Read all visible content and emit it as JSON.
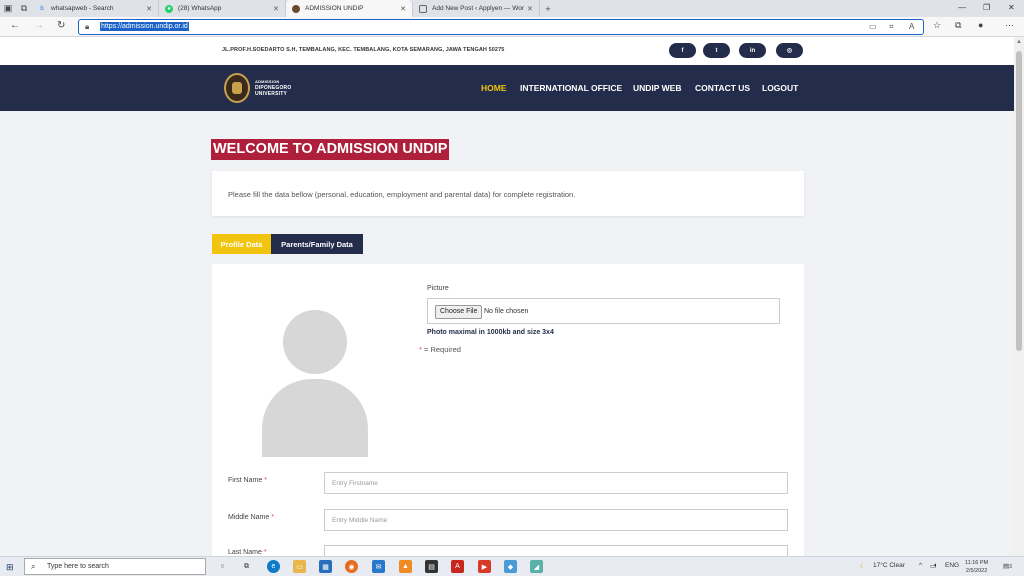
{
  "browser": {
    "tabs": [
      {
        "title": "whatsapweb - Search",
        "icon": "bing-icon",
        "color": "#1a73e8"
      },
      {
        "title": "(28) WhatsApp",
        "icon": "whatsapp-icon",
        "color": "#25d366"
      },
      {
        "title": "ADMISSION UNDIP",
        "icon": "undip-icon",
        "color": "#6b4a2e"
      },
      {
        "title": "Add New Post ‹ Applyen — Wor",
        "icon": "page-icon",
        "color": "#666666"
      }
    ],
    "new_tab": "+",
    "url": "https://admission.undip.or.id"
  },
  "site": {
    "address": "JL.PROF.H.SOEDARTO S.H, TEMBALANG, KEC. TEMBALANG, KOTA SEMARANG, JAWA TENGAH 50275",
    "social": [
      "f",
      "t",
      "in",
      "◎"
    ],
    "logo": {
      "line1": "ADMISSION",
      "line2": "DIPONEGORO",
      "line3": "UNIVERSITY"
    },
    "menu": [
      "HOME",
      "INTERNATIONAL OFFICE",
      "UNDIP WEB",
      "CONTACT US",
      "LOGOUT"
    ],
    "active_menu": "HOME",
    "welcome": "WELCOME TO ADMISSION UNDIP",
    "intro": "Please fill the data bellow (personal, education, employment and parental data) for complete registration.",
    "form_tabs": [
      "Profile Data",
      "Parents/Family Data"
    ],
    "picture_label": "Picture",
    "choose_file": "Choose File",
    "no_file": "No file chosen",
    "photo_hint": "Photo maximal in 1000kb and size 3x4",
    "required_mark": "*",
    "required_text": " = Required",
    "fields": [
      {
        "label": "First Name",
        "placeholder": "Entry Firstname"
      },
      {
        "label": "Middle Name",
        "placeholder": "Entry Middle Name"
      },
      {
        "label": "Last Name",
        "placeholder": ""
      }
    ]
  },
  "taskbar": {
    "search_placeholder": "Type here to search",
    "weather": "17°C  Clear",
    "lang": "ENG",
    "time": "11:16 PM",
    "date": "2/5/2022",
    "notification_count": "3"
  },
  "colors": {
    "navy": "#232c4a",
    "gold": "#f1c40f",
    "crimson": "#ad1f3b"
  }
}
